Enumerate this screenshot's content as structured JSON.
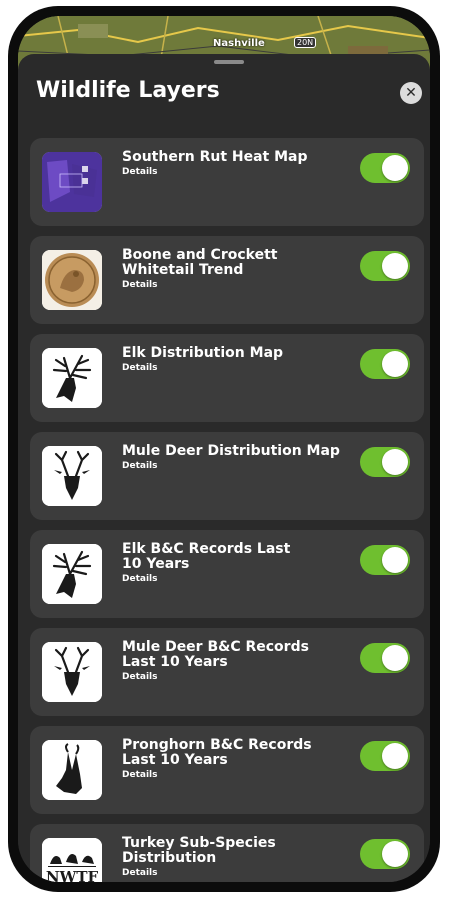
{
  "map": {
    "city_label": "Nashville",
    "route_badge": "20N"
  },
  "sheet": {
    "title": "Wildlife Layers",
    "close_icon": "close-icon"
  },
  "colors": {
    "toggle_on": "#6fbf2f",
    "card_bg": "#3c3c3c",
    "sheet_bg": "#2a2a2a"
  },
  "layers": [
    {
      "line1": "Southern Rut Heat Map",
      "line2": "",
      "details": "Details",
      "icon": "heat-map-thumbnail",
      "enabled": true
    },
    {
      "line1": "Boone and Crockett",
      "line2": "Whitetail Trend",
      "details": "Details",
      "icon": "boone-crockett-medal-icon",
      "enabled": true
    },
    {
      "line1": "Elk Distribution Map",
      "line2": "",
      "details": "Details",
      "icon": "elk-head-icon",
      "enabled": true
    },
    {
      "line1": "Mule Deer Distribution Map",
      "line2": "",
      "details": "Details",
      "icon": "mule-deer-head-icon",
      "enabled": true
    },
    {
      "line1": "Elk B&C Records Last",
      "line2": "10 Years",
      "details": "Details",
      "icon": "elk-head-icon",
      "enabled": true
    },
    {
      "line1": " Mule Deer B&C Records",
      "line2": "Last 10 Years",
      "details": "Details",
      "icon": "mule-deer-head-icon",
      "enabled": true
    },
    {
      "line1": "Pronghorn B&C Records",
      "line2": "Last 10 Years",
      "details": "Details",
      "icon": "pronghorn-head-icon",
      "enabled": true
    },
    {
      "line1": "Turkey Sub-Species",
      "line2": "Distribution",
      "details": "Details",
      "icon": "nwtf-logo-icon",
      "logo_text": "NWTF",
      "enabled": true
    }
  ]
}
